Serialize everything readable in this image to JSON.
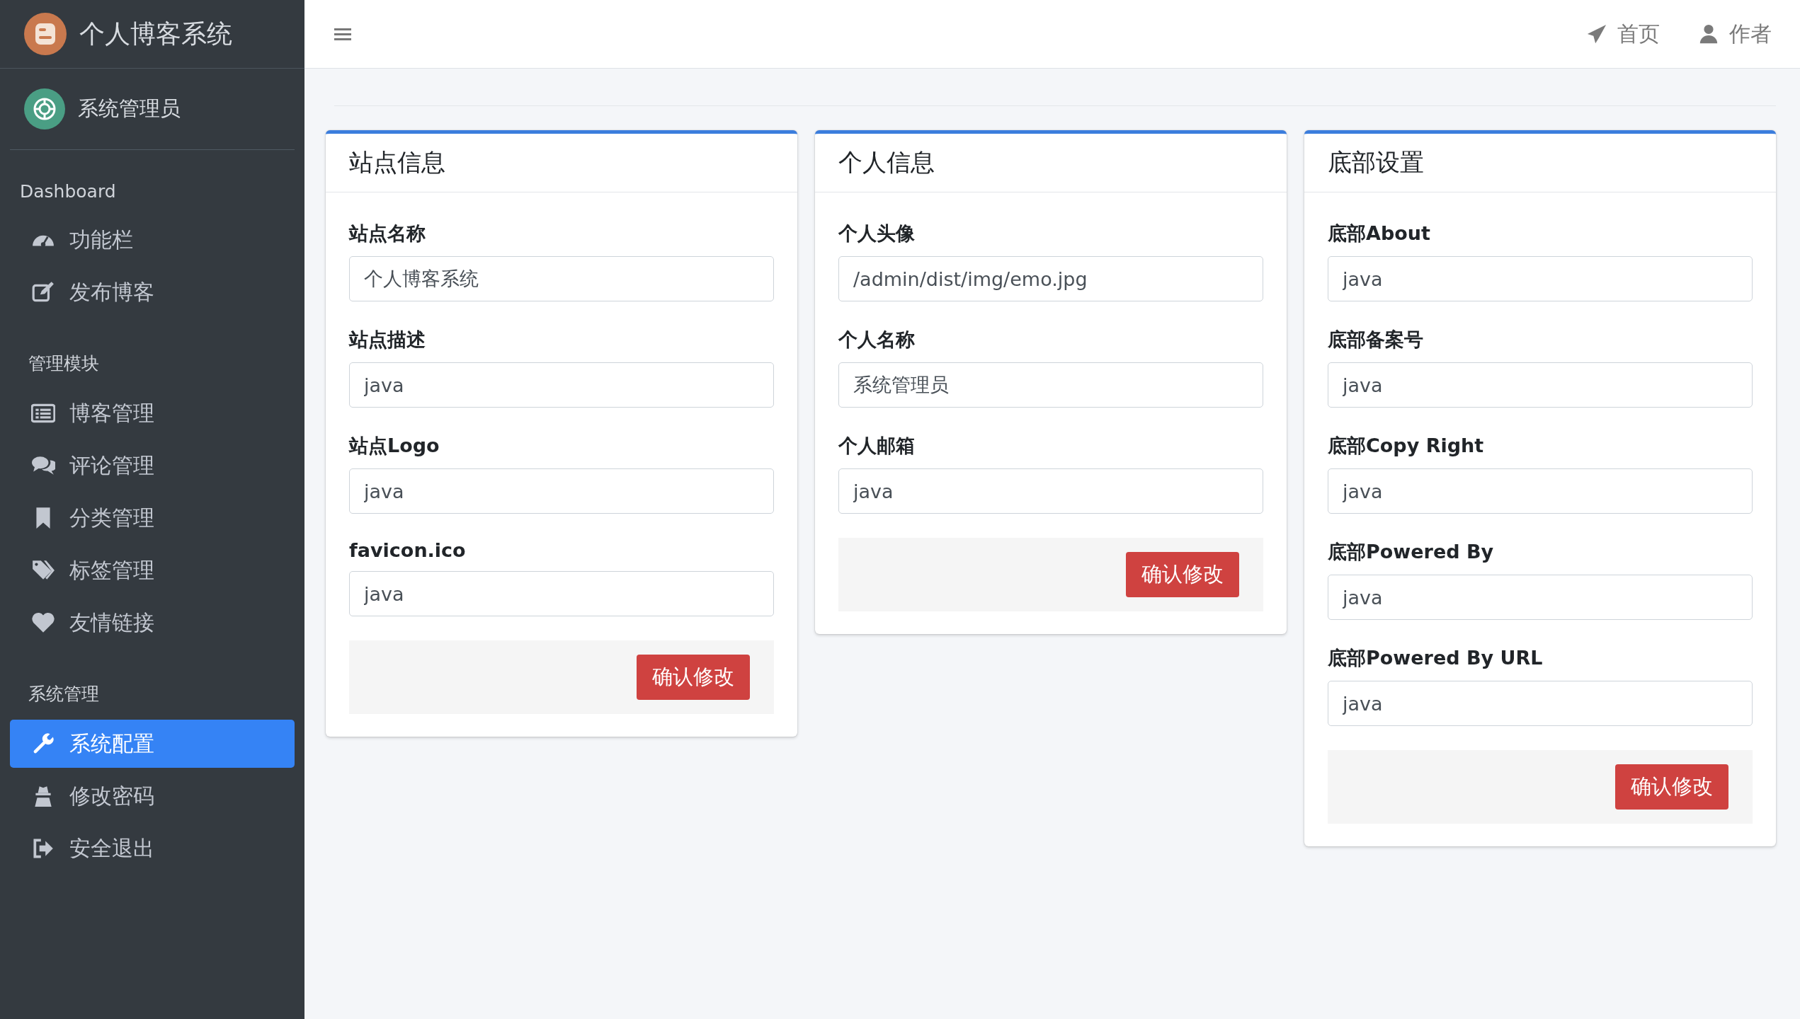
{
  "sidebar": {
    "brand": {
      "title": "个人博客系统"
    },
    "user": {
      "name": "系统管理员"
    },
    "sections": [
      {
        "heading": "Dashboard",
        "items": [
          {
            "label": "功能栏",
            "selected": false
          },
          {
            "label": "发布博客",
            "selected": false
          }
        ]
      },
      {
        "heading": "管理模块",
        "items": [
          {
            "label": "博客管理",
            "selected": false
          },
          {
            "label": "评论管理",
            "selected": false
          },
          {
            "label": "分类管理",
            "selected": false
          },
          {
            "label": "标签管理",
            "selected": false
          },
          {
            "label": "友情链接",
            "selected": false
          }
        ]
      },
      {
        "heading": "系统管理",
        "items": [
          {
            "label": "系统配置",
            "selected": true
          },
          {
            "label": "修改密码",
            "selected": false
          },
          {
            "label": "安全退出",
            "selected": false
          }
        ]
      }
    ]
  },
  "topbar": {
    "links": [
      {
        "label": "首页"
      },
      {
        "label": "作者"
      }
    ]
  },
  "cards": [
    {
      "title": "站点信息",
      "fields": [
        {
          "label": "站点名称",
          "value": "个人博客系统"
        },
        {
          "label": "站点描述",
          "value": "java"
        },
        {
          "label": "站点Logo",
          "value": "java"
        },
        {
          "label": "favicon.ico",
          "value": "java"
        }
      ],
      "button": "确认修改"
    },
    {
      "title": "个人信息",
      "fields": [
        {
          "label": "个人头像",
          "value": "/admin/dist/img/emo.jpg"
        },
        {
          "label": "个人名称",
          "value": "系统管理员"
        },
        {
          "label": "个人邮箱",
          "value": "java"
        }
      ],
      "button": "确认修改"
    },
    {
      "title": "底部设置",
      "fields": [
        {
          "label": "底部About",
          "value": "java"
        },
        {
          "label": "底部备案号",
          "value": "java"
        },
        {
          "label": "底部Copy Right",
          "value": "java"
        },
        {
          "label": "底部Powered By",
          "value": "java"
        },
        {
          "label": "底部Powered By URL",
          "value": "java"
        }
      ],
      "button": "确认修改"
    }
  ]
}
